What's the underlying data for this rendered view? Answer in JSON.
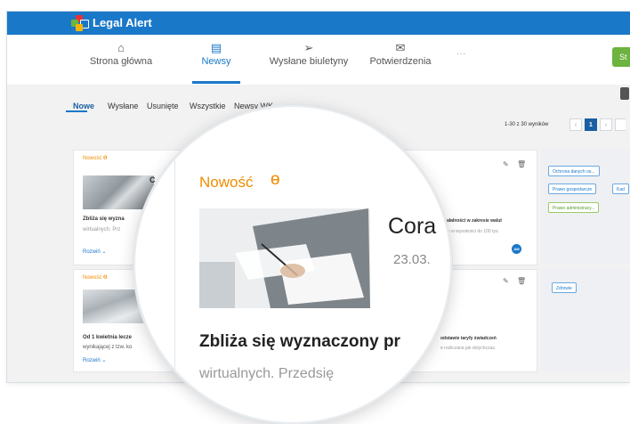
{
  "app": {
    "title": "Legal Alert",
    "logo_colors": [
      "#e8312f",
      "#6cb33f",
      "#1a78c9",
      "#f5b400"
    ]
  },
  "nav": {
    "items": [
      {
        "label": "Strona główna",
        "icon": "home-icon"
      },
      {
        "label": "Newsy",
        "icon": "news-icon",
        "active": true
      },
      {
        "label": "Wysłane biuletyny",
        "icon": "send-icon"
      },
      {
        "label": "Potwierdzenia",
        "icon": "confirm-icon"
      }
    ],
    "more": "...",
    "action_button": "St"
  },
  "subtabs": [
    "Nowe",
    "Wysłane",
    "Usunięte",
    "Wszystkie",
    "Newsy WK"
  ],
  "pager": {
    "summary": "1-30 z 30 wyników",
    "current": "1"
  },
  "cards": [
    {
      "label": "Nowość",
      "title_fragment": "C",
      "title_right": "w",
      "line1": "Zbliża się wyzna",
      "line2": "wirtualnych. Prz",
      "right1": "działalności w zakresie walut",
      "right2": "ażna w wysokości do 100 tys.",
      "avatar": "AM",
      "expand": "Rozwiń",
      "tags": [
        {
          "label": "Ochrona danych os...",
          "color": "blue"
        },
        {
          "label": "Prawo gospodarcze",
          "color": "blue"
        },
        {
          "label": "Kad",
          "color": "blue"
        },
        {
          "label": "Prawo administracy...",
          "color": "green"
        }
      ]
    },
    {
      "label": "Nowość",
      "line1": "Od 1 kwietnia lecze",
      "line2": "wynikającej z tzw. ko",
      "right1": "odstawie taryfy świadczeń",
      "right2": "e rozliczana jak dotychczas.",
      "expand": "Rozwiń",
      "tags": [
        {
          "label": "Zdrowie",
          "color": "blue"
        }
      ]
    }
  ],
  "lens": {
    "label": "Nowość",
    "title_fragment": "Cora",
    "date": "23.03.",
    "headline": "Zbliża się wyznaczony pr",
    "sub": "wirtualnych. Przedsię"
  }
}
